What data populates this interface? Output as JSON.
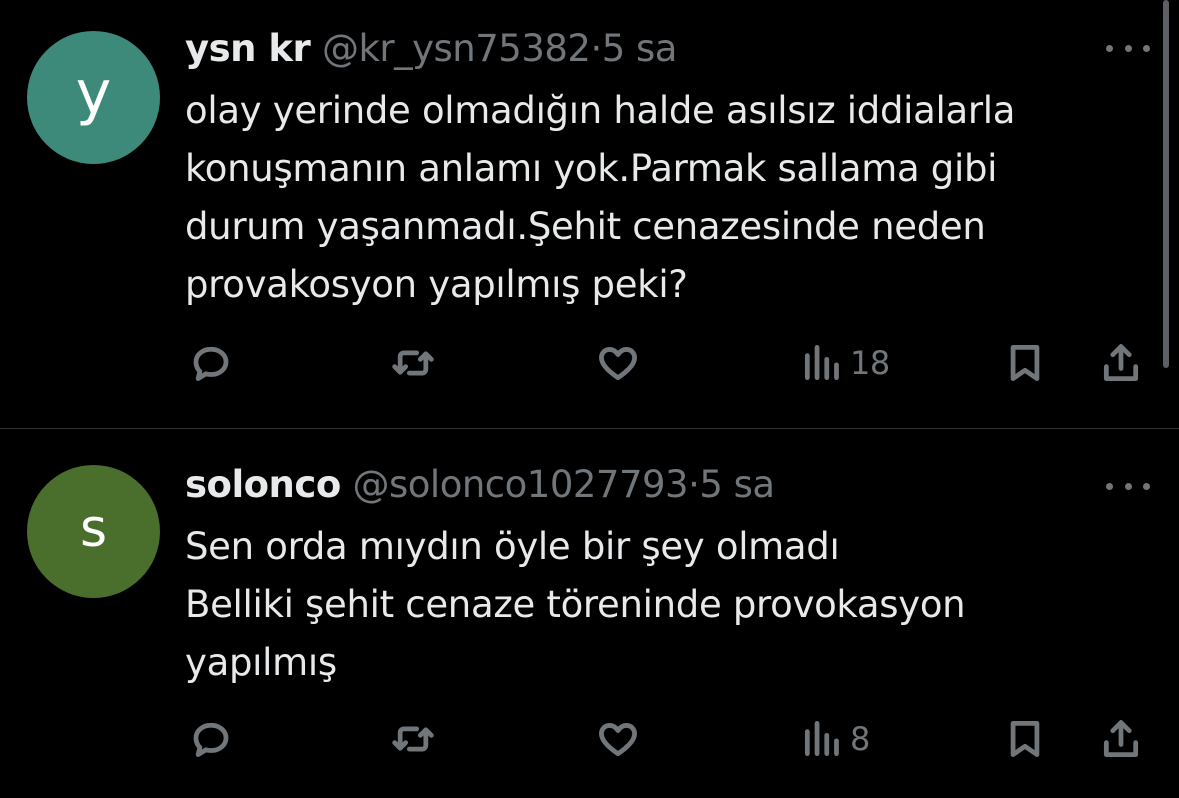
{
  "colors": {
    "background": "#000000",
    "text_primary": "#e7e9ea",
    "text_secondary": "#71767b",
    "divider": "#2f3336"
  },
  "tweets": [
    {
      "avatar": {
        "letter": "y",
        "color": "#3d8a7a"
      },
      "display_name": "ysn kr",
      "handle": "@kr_ysn75382",
      "separator": "·",
      "time": "5 sa",
      "more_icon": "more-horizontal-icon",
      "text_lines": [
        "olay yerinde olmadığın halde asılsız iddialarla",
        "konuşmanın anlamı yok.Parmak sallama gibi",
        "durum yaşanmadı.Şehit cenazesinde neden",
        "provakosyon yapılmış peki?"
      ],
      "actions": {
        "reply_icon": "reply-icon",
        "retweet_icon": "retweet-icon",
        "like_icon": "heart-icon",
        "views_icon": "views-icon",
        "views_count": "18",
        "bookmark_icon": "bookmark-icon",
        "share_icon": "share-icon"
      }
    },
    {
      "avatar": {
        "letter": "s",
        "color": "#4a6e2c"
      },
      "display_name": "solonco",
      "handle": "@solonco1027793",
      "separator": "·",
      "time": "5 sa",
      "more_icon": "more-horizontal-icon",
      "text_lines": [
        "Sen orda mıydın öyle bir şey olmadı",
        "Belliki şehit cenaze töreninde provokasyon",
        "yapılmış"
      ],
      "actions": {
        "reply_icon": "reply-icon",
        "retweet_icon": "retweet-icon",
        "like_icon": "heart-icon",
        "views_icon": "views-icon",
        "views_count": "8",
        "bookmark_icon": "bookmark-icon",
        "share_icon": "share-icon"
      }
    }
  ]
}
